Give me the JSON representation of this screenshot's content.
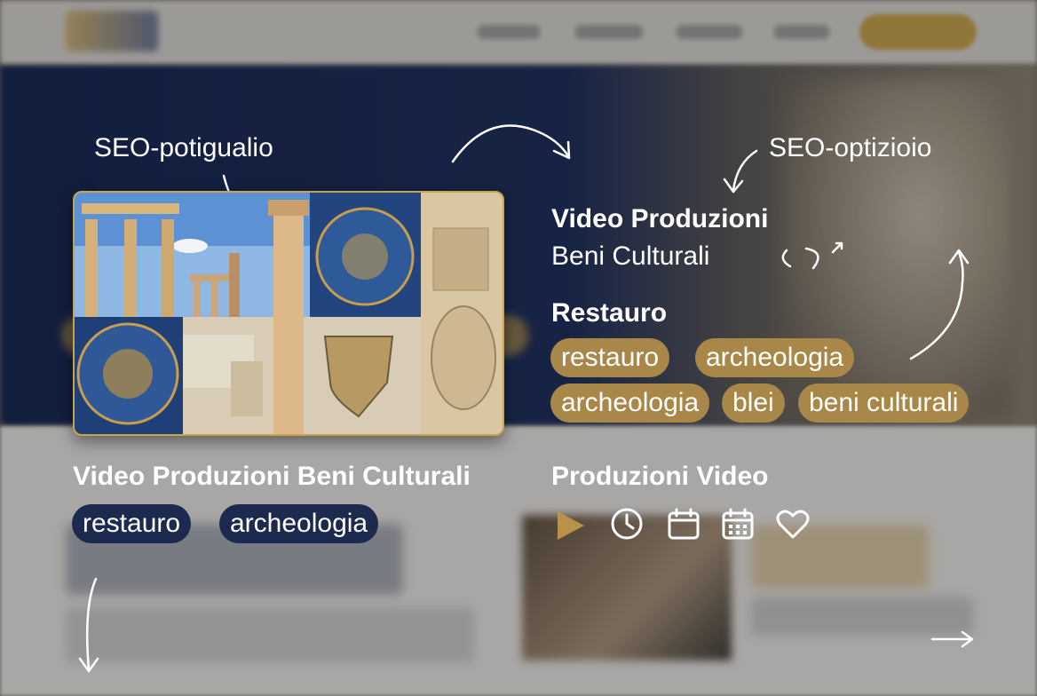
{
  "annotations": {
    "left_label": "SEO-potigualio",
    "right_label": "SEO-optizioio"
  },
  "feature": {
    "title": "Video Produzioni",
    "subtitle": "Beni Culturali",
    "section_title": "Restauro",
    "tags": [
      "restauro",
      "archeologia",
      "archeologia",
      "blei",
      "beni culturali"
    ]
  },
  "card": {
    "title": "Video Produzioni Beni Culturali",
    "tags": [
      "restauro",
      "archeologia"
    ]
  },
  "media": {
    "title": "Produzioni Video",
    "icons": [
      "play-icon",
      "clock-icon",
      "calendar-icon",
      "calendar-grid-icon",
      "heart-icon"
    ]
  },
  "colors": {
    "gold": "#a98748",
    "navy": "#1b2a4e",
    "hero_navy": "#13244f"
  }
}
